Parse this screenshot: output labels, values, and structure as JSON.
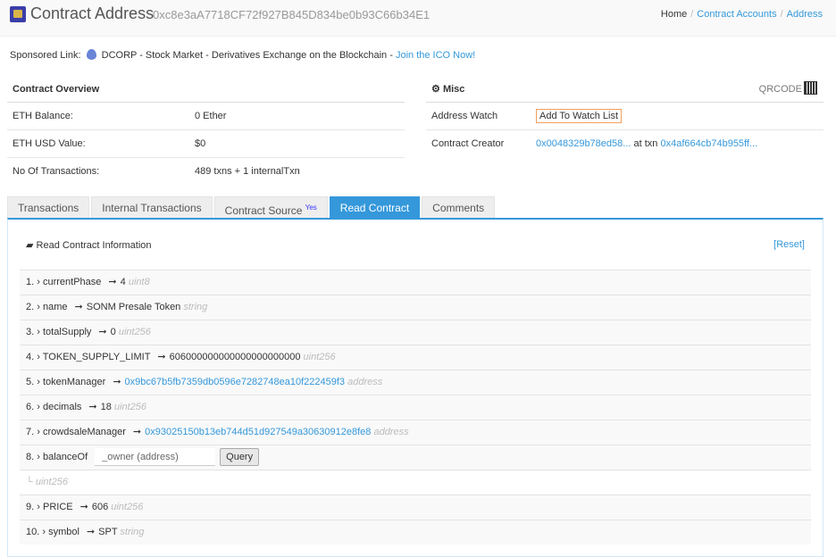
{
  "header": {
    "title": "Contract Address",
    "address": "0xc8e3aA7718CF72f927B845D834be0b93C66b34E1",
    "breadcrumb": [
      "Home",
      "Contract Accounts",
      "Address"
    ]
  },
  "sponsored": {
    "label": "Sponsored Link:",
    "text": "DCORP - Stock Market - Derivatives Exchange on the Blockchain -",
    "link": "Join the ICO Now!"
  },
  "overview": {
    "title": "Contract Overview",
    "rows": [
      {
        "label": "ETH Balance:",
        "value": "0 Ether"
      },
      {
        "label": "ETH USD Value:",
        "value": "$0"
      },
      {
        "label": "No Of Transactions:",
        "value": "489 txns + 1 internalTxn"
      }
    ]
  },
  "misc": {
    "title": "Misc",
    "qrcode": "QRCODE",
    "watch_label": "Address Watch",
    "watch_button": "Add To Watch List",
    "creator_label": "Contract Creator",
    "creator_addr": "0x0048329b78ed58...",
    "at_txn": "at txn",
    "creator_txn": "0x4af664cb74b955ff..."
  },
  "tabs": [
    {
      "label": "Transactions"
    },
    {
      "label": "Internal Transactions"
    },
    {
      "label": "Contract Source",
      "badge": "Yes"
    },
    {
      "label": "Read Contract"
    },
    {
      "label": "Comments"
    }
  ],
  "read": {
    "title": "Read Contract Information",
    "reset": "[Reset]",
    "rows": [
      {
        "n": "1.",
        "name": "currentPhase",
        "value": "4",
        "type": "uint8"
      },
      {
        "n": "2.",
        "name": "name",
        "value": "SONM Presale Token",
        "type": "string"
      },
      {
        "n": "3.",
        "name": "totalSupply",
        "value": "0",
        "type": "uint256"
      },
      {
        "n": "4.",
        "name": "TOKEN_SUPPLY_LIMIT",
        "value": "606000000000000000000000",
        "type": "uint256"
      },
      {
        "n": "5.",
        "name": "tokenManager",
        "value": "0x9bc67b5fb7359db0596e7282748ea10f222459f3",
        "type": "address"
      },
      {
        "n": "6.",
        "name": "decimals",
        "value": "18",
        "type": "uint256"
      },
      {
        "n": "7.",
        "name": "crowdsaleManager",
        "value": "0x93025150b13eb744d51d927549a30630912e8fe8",
        "type": "address"
      }
    ],
    "balance": {
      "n": "8.",
      "name": "balanceOf",
      "placeholder": "_owner (address)",
      "button": "Query",
      "type": "uint256"
    },
    "rows2": [
      {
        "n": "9.",
        "name": "PRICE",
        "value": "606",
        "type": "uint256"
      },
      {
        "n": "10.",
        "name": "symbol",
        "value": "SPT",
        "type": "string"
      }
    ]
  }
}
